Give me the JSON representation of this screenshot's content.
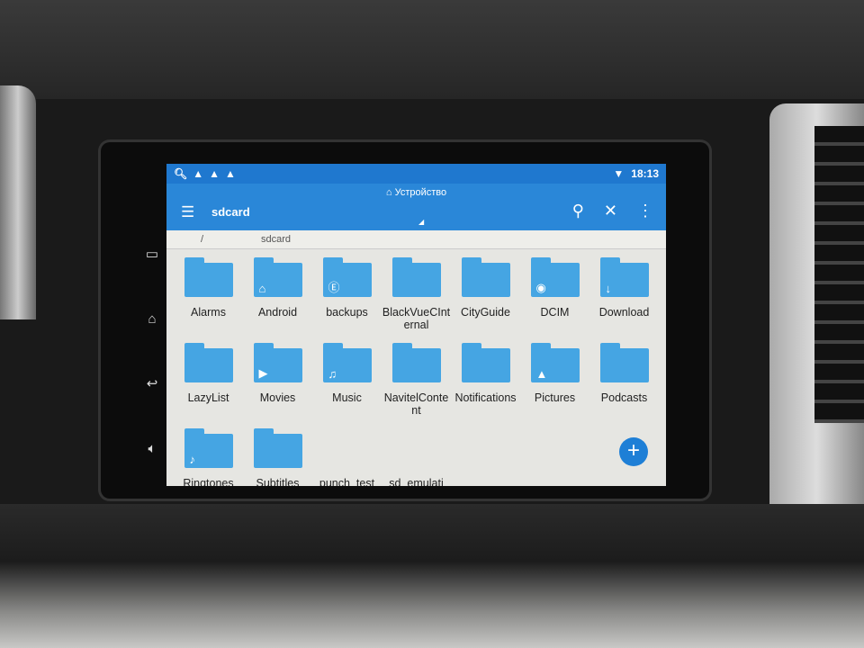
{
  "status_bar": {
    "left_icons": [
      "search-icon",
      "warning-icon",
      "warning-icon",
      "warning-icon"
    ],
    "wifi": "wifi-icon",
    "time": "18:13"
  },
  "toolbar": {
    "location": "Устройство",
    "title": "sdcard"
  },
  "breadcrumb": [
    "/",
    "sdcard"
  ],
  "folders": [
    {
      "name": "Alarms",
      "icon": ""
    },
    {
      "name": "Android",
      "icon": "⌂"
    },
    {
      "name": "backups",
      "icon": "Ⓔ"
    },
    {
      "name": "BlackVueCInternal",
      "icon": ""
    },
    {
      "name": "CityGuide",
      "icon": ""
    },
    {
      "name": "DCIM",
      "icon": "◉"
    },
    {
      "name": "Download",
      "icon": "↓"
    },
    {
      "name": "LazyList",
      "icon": ""
    },
    {
      "name": "Movies",
      "icon": "▶"
    },
    {
      "name": "Music",
      "icon": "♫"
    },
    {
      "name": "NavitelContent",
      "icon": ""
    },
    {
      "name": "Notifications",
      "icon": ""
    },
    {
      "name": "Pictures",
      "icon": "▲"
    },
    {
      "name": "Podcasts",
      "icon": ""
    },
    {
      "name": "Ringtones",
      "icon": "♪"
    },
    {
      "name": "Subtitles",
      "icon": ""
    },
    {
      "name": "punch_test",
      "icon": null
    },
    {
      "name": "sd_emulati",
      "icon": null
    }
  ],
  "accent": "#2a87d8"
}
